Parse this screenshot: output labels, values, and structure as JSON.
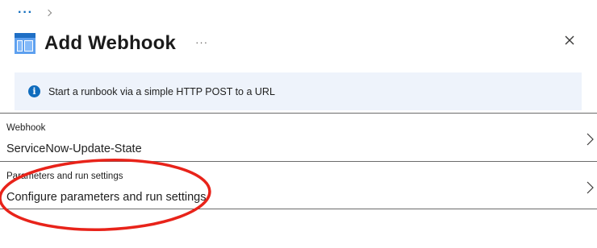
{
  "breadcrumb": {
    "more_label": "···"
  },
  "header": {
    "title": "Add Webhook",
    "more_label": "···",
    "icon": "blade-icon",
    "close_icon": "close-icon"
  },
  "info_bar": {
    "icon": "info-icon",
    "icon_glyph": "i",
    "text": "Start a runbook via a simple HTTP POST to a URL"
  },
  "rows": [
    {
      "label": "Webhook",
      "value": "ServiceNow-Update-State"
    },
    {
      "label": "Parameters and run settings",
      "value": "Configure parameters and run settings"
    }
  ],
  "colors": {
    "accent": "#0f6cbd",
    "info_background": "#eef3fb",
    "annotation": "#e8231a"
  }
}
